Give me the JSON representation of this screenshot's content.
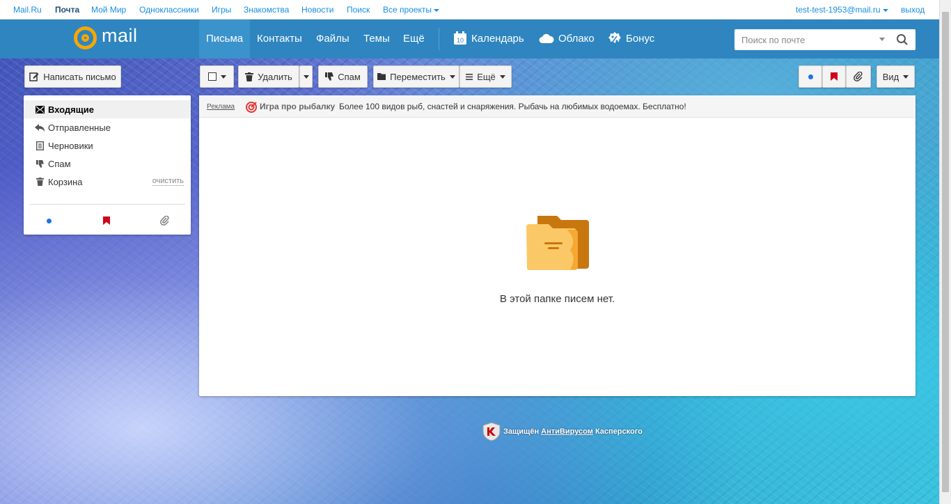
{
  "portal": {
    "links": [
      "Mail.Ru",
      "Почта",
      "Мой Мир",
      "Одноклассники",
      "Игры",
      "Знакомства",
      "Новости",
      "Поиск",
      "Все проекты"
    ],
    "user": "test-test-1953@mail.ru",
    "logout": "выход"
  },
  "logo": {
    "word": "mail"
  },
  "nav": {
    "items": [
      "Письма",
      "Контакты",
      "Файлы",
      "Темы",
      "Ещё"
    ],
    "services": [
      "Календарь",
      "Облако",
      "Бонус"
    ],
    "calendar_day": "10"
  },
  "search": {
    "placeholder": "Поиск по почте"
  },
  "toolbar": {
    "compose": "Написать письмо",
    "delete": "Удалить",
    "spam": "Спам",
    "move": "Переместить",
    "more": "Ещё",
    "view": "Вид"
  },
  "folders": [
    {
      "label": "Входящие",
      "icon": "envelope-icon"
    },
    {
      "label": "Отправленные",
      "icon": "reply-icon"
    },
    {
      "label": "Черновики",
      "icon": "draft-icon"
    },
    {
      "label": "Спам",
      "icon": "thumbs-down-icon"
    },
    {
      "label": "Корзина",
      "icon": "trash-icon"
    }
  ],
  "trash_clear": "очистить",
  "ad": {
    "label": "Реклама",
    "title": "Игра про рыбалку",
    "text": "Более 100 видов рыб, снастей и снаряжения. Рыбачь на любимых водоемах. Бесплатно!"
  },
  "empty": {
    "message": "В этой папке писем нет."
  },
  "footer": {
    "protected_prefix": "Защищён",
    "antivirus": "АнтиВирусом",
    "brand": "Касперского"
  },
  "colors": {
    "header": "#2e85c0",
    "link": "#168de2",
    "logo_accent": "#f7a700",
    "unread_dot": "#1a73e8",
    "flag": "#d0021b"
  }
}
